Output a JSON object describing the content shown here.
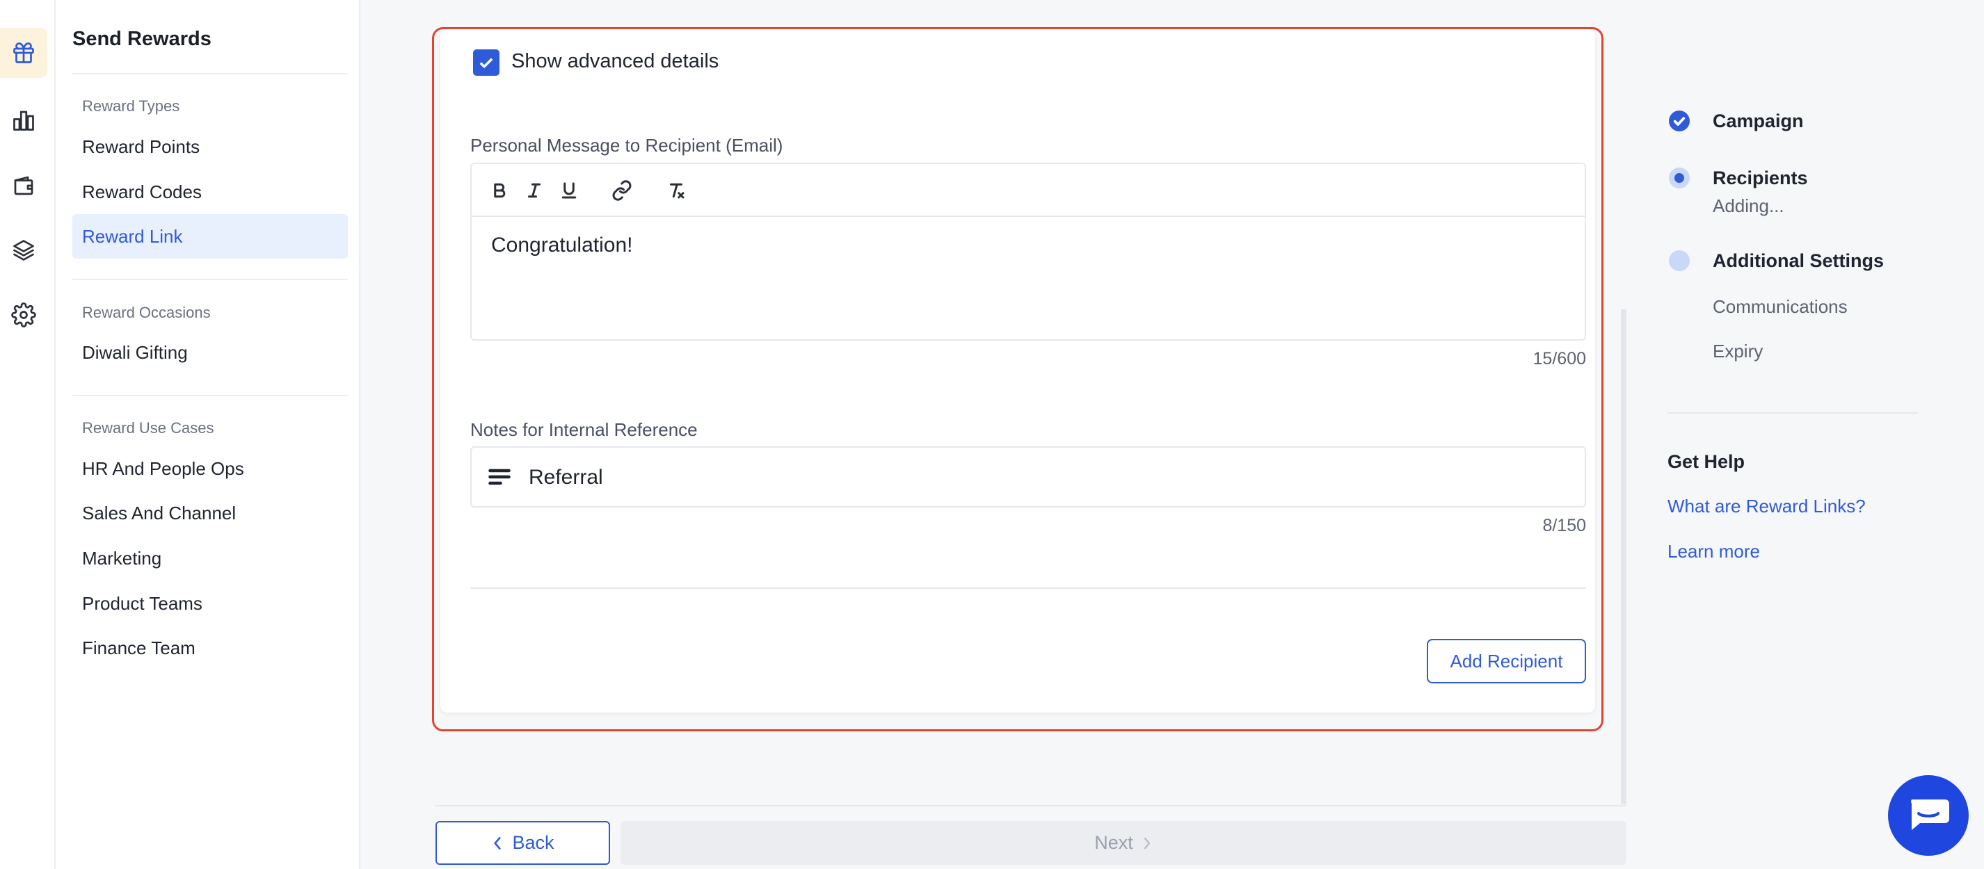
{
  "sidebar": {
    "title": "Send Rewards",
    "sections": [
      {
        "heading": "Reward Types",
        "items": [
          "Reward Points",
          "Reward Codes",
          "Reward Link"
        ]
      },
      {
        "heading": "Reward Occasions",
        "items": [
          "Diwali Gifting"
        ]
      },
      {
        "heading": "Reward Use Cases",
        "items": [
          "HR And People Ops",
          "Sales And Channel",
          "Marketing",
          "Product Teams",
          "Finance Team"
        ]
      }
    ],
    "active_item": "Reward Link"
  },
  "rail": {
    "icons": [
      "gift-icon",
      "bar-chart-icon",
      "wallet-icon",
      "layers-icon",
      "gear-icon"
    ],
    "active": "gift-icon"
  },
  "form": {
    "advanced_checkbox_label": "Show advanced details",
    "advanced_checked": true,
    "message_label": "Personal Message to Recipient (Email)",
    "message_value": "Congratulation!",
    "message_counter": "15/600",
    "notes_label": "Notes for Internal Reference",
    "notes_value": "Referral",
    "notes_counter": "8/150",
    "add_recipient_label": "Add Recipient"
  },
  "footer": {
    "back_label": "Back",
    "next_label": "Next"
  },
  "stepper": {
    "steps": [
      {
        "label": "Campaign",
        "state": "complete"
      },
      {
        "label": "Recipients",
        "state": "current",
        "sub": "Adding..."
      },
      {
        "label": "Additional Settings",
        "state": "upcoming",
        "subs": [
          "Communications",
          "Expiry"
        ]
      }
    ]
  },
  "help": {
    "title": "Get Help",
    "links": [
      "What are Reward Links?",
      "Learn more"
    ]
  },
  "colors": {
    "accent": "#2f5bd8",
    "highlight_outline": "#e2452f",
    "chat": "#1f47e0"
  }
}
